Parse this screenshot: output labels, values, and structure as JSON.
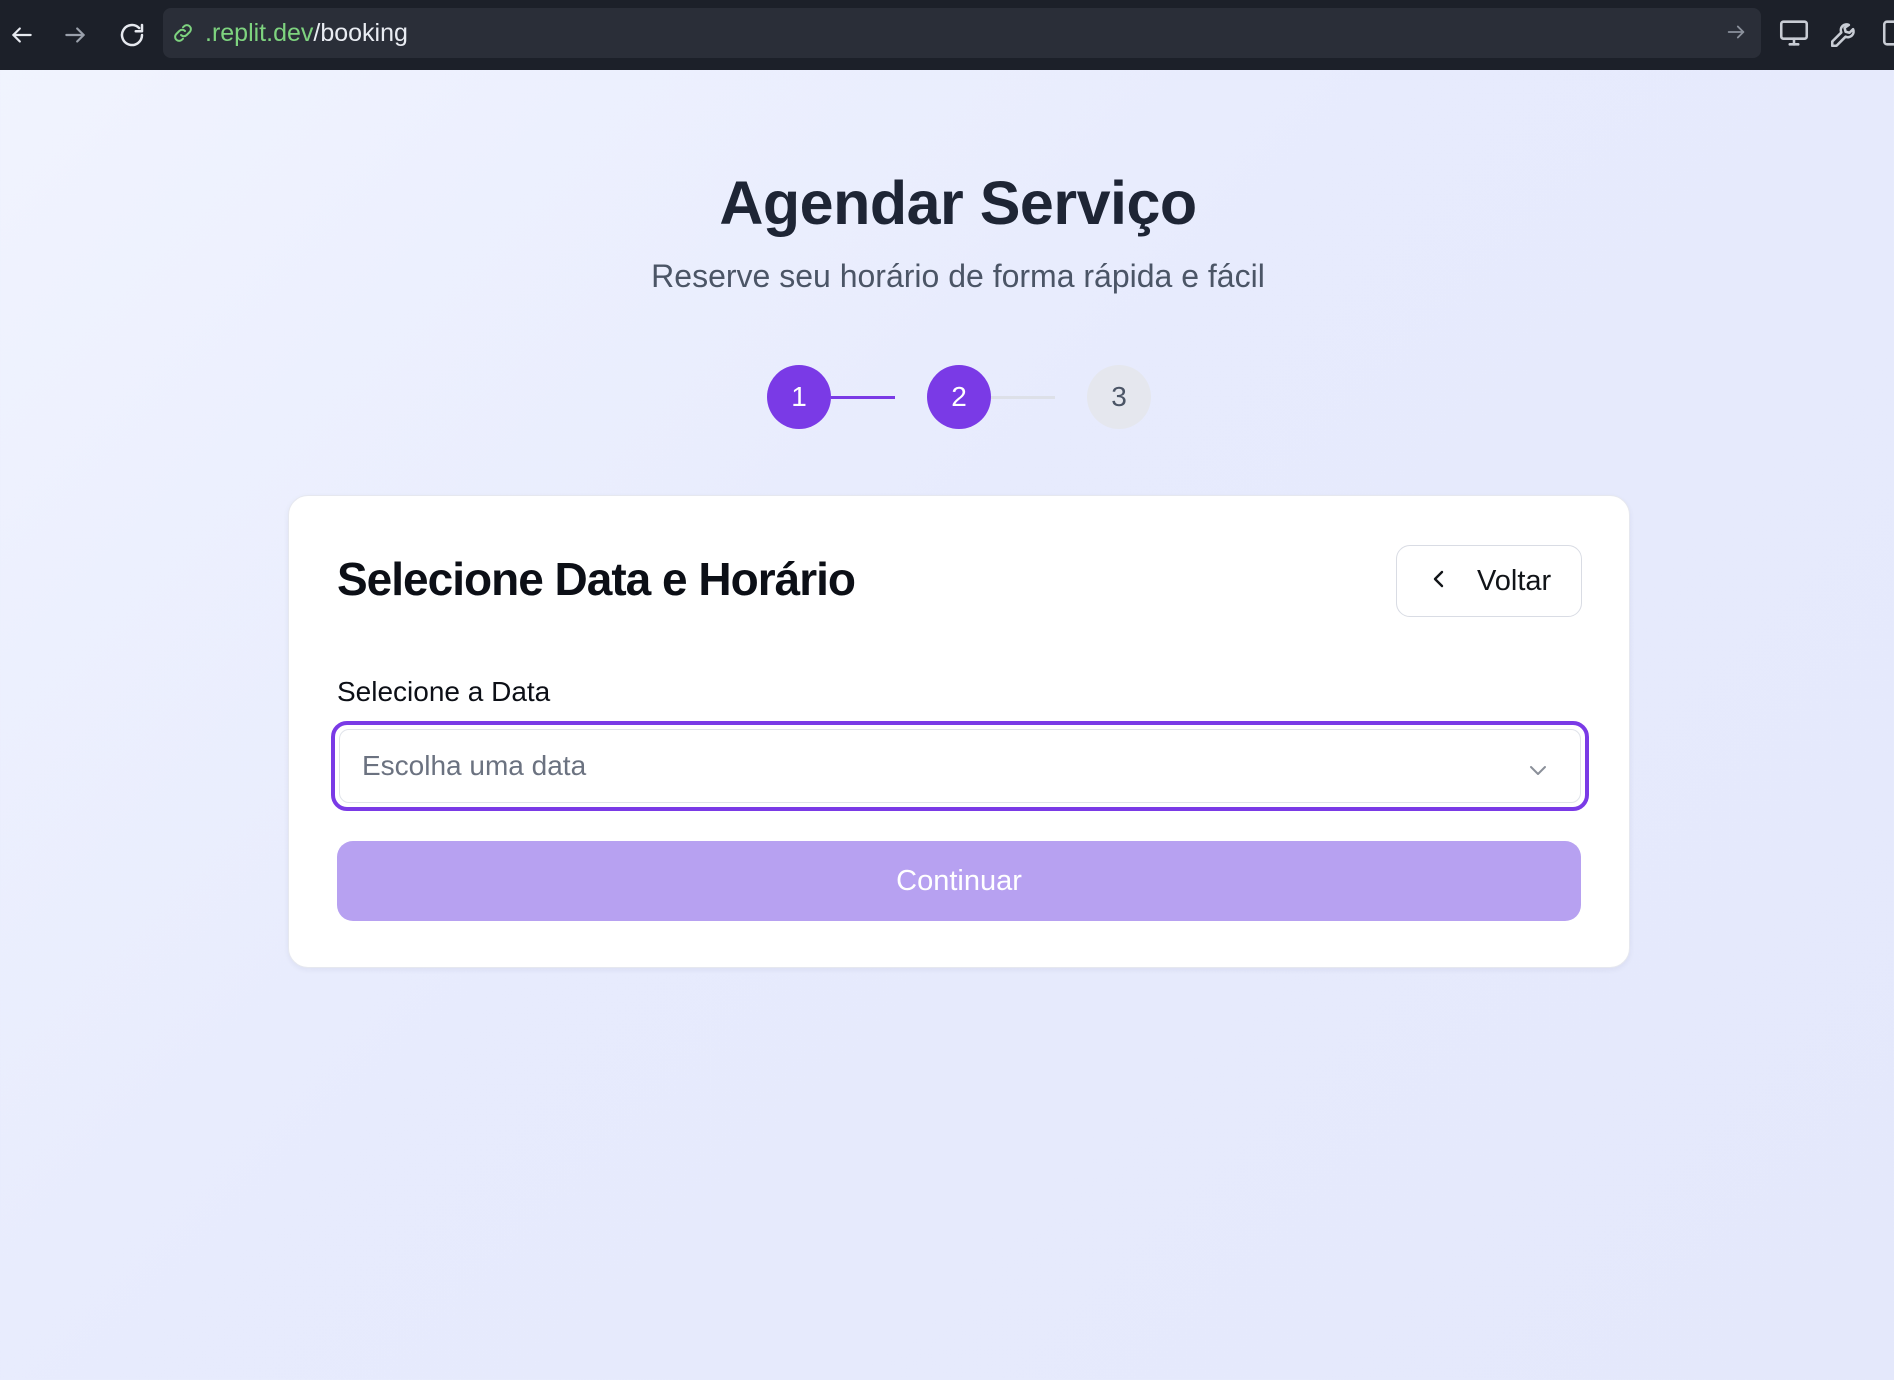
{
  "browser": {
    "url_host": ".replit.dev",
    "url_path": "/booking",
    "icons": [
      "back-arrow-icon",
      "forward-arrow-icon",
      "reload-icon",
      "link-icon",
      "go-arrow-icon",
      "monitor-icon",
      "wrench-icon"
    ]
  },
  "header": {
    "title": "Agendar Serviço",
    "subtitle": "Reserve seu horário de forma rápida e fácil"
  },
  "stepper": {
    "steps": [
      "1",
      "2",
      "3"
    ],
    "current_step": 2,
    "active_color": "#7a3ae6"
  },
  "card": {
    "title": "Selecione Data e Horário",
    "back_label": "Voltar",
    "date_label": "Selecione a Data",
    "date_placeholder": "Escolha uma data",
    "continue_label": "Continuar"
  }
}
